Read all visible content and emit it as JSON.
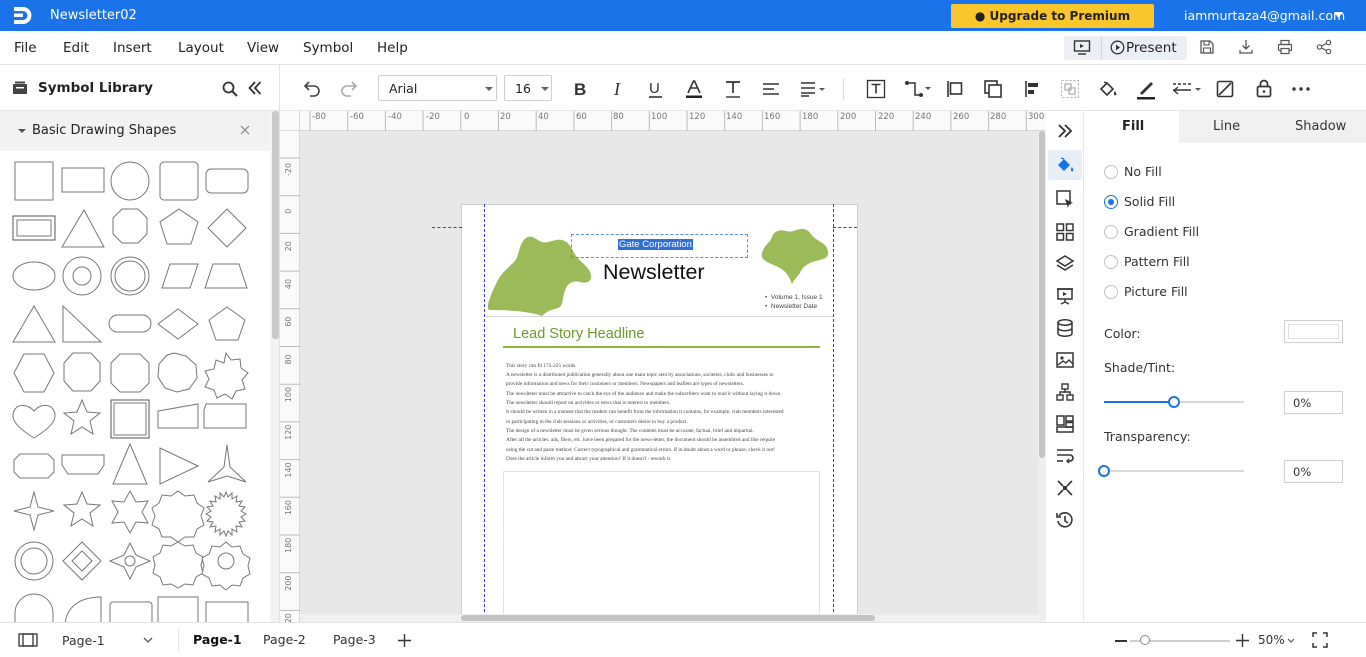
{
  "app": {
    "document_title": "Newsletter02",
    "premium_button": "● Upgrade to Premium Version",
    "account": "iammurtaza4@gmail.com"
  },
  "menu": {
    "items": [
      "File",
      "Edit",
      "Insert",
      "Layout",
      "View",
      "Symbol",
      "Help"
    ],
    "present_label": "Present"
  },
  "toolbar": {
    "font_name": "Arial",
    "font_size": "16"
  },
  "symbol_library": {
    "title": "Symbol Library",
    "section": "Basic Drawing Shapes"
  },
  "ruler": {
    "top": [
      "-80",
      "-60",
      "-40",
      "-20",
      "0",
      "20",
      "40",
      "60",
      "80",
      "100",
      "120",
      "140",
      "160",
      "180",
      "200",
      "220",
      "240",
      "260",
      "280",
      "300"
    ],
    "left": [
      "-20",
      "0",
      "20",
      "40",
      "60",
      "80",
      "100",
      "120",
      "140",
      "160",
      "180",
      "200",
      "220"
    ]
  },
  "document": {
    "company": "Gate Corporation",
    "title": "Newsletter",
    "bullets": [
      "Volume 1, Issue 1",
      "Newsletter Date"
    ],
    "headline": "Lead Story Headline",
    "body_lines": [
      "This story can fit 175-225 words.",
      "A newsletter is a distributed publication generally about one main topic sent by associations, societies, clubs and businesses to",
      "provide information and news for their customers or members.  Newspapers and leaflets are types of newsletters.",
      "The newsletter must be attractive to catch the eye of the audience and make the subscribers want to read it without laying it down.",
      "The newsletter should report on activities or news that is interest to members.",
      "It should be written in a manner that the readers can benefit from the information it contains, for example, club members interested",
      "in participating in the club sessions or activities, or customers desire to buy a product.",
      "The design of a newsletter must be given serious thought. The contents must be accurate, factual, brief and impartial.",
      "After all the articles, ads, fliers, etc. have been prepared for the news-letter, the document should be assembled and like require",
      "using the cut and paste method.  Correct typographical and grammatical errors. If in doubt about a word or phrase, check it out!",
      "Does the article inform you and attract your attention? If it doesn't - rework it."
    ]
  },
  "properties": {
    "tabs": [
      "Fill",
      "Line",
      "Shadow"
    ],
    "active_tab": "Fill",
    "fill_options": [
      "No Fill",
      "Solid Fill",
      "Gradient Fill",
      "Pattern Fill",
      "Picture Fill"
    ],
    "selected_fill": "Solid Fill",
    "color_label": "Color:",
    "color_value": "#ffffff",
    "shade_label": "Shade/Tint:",
    "shade_value": "0%",
    "shade_slider_fraction": 0.5,
    "transparency_label": "Transparency:",
    "transparency_value": "0%",
    "transparency_slider_fraction": 0.0
  },
  "status": {
    "page_select": "Page-1",
    "pages": [
      "Page-1",
      "Page-2",
      "Page-3"
    ],
    "active_page": "Page-1",
    "zoom": "50%"
  },
  "colors": {
    "title_bar": "#1a73e8",
    "premium": "#f9c62b",
    "accent": "#1a73e8",
    "leaf_green": "#9bbb59",
    "headline_green": "#6d9a2a"
  }
}
